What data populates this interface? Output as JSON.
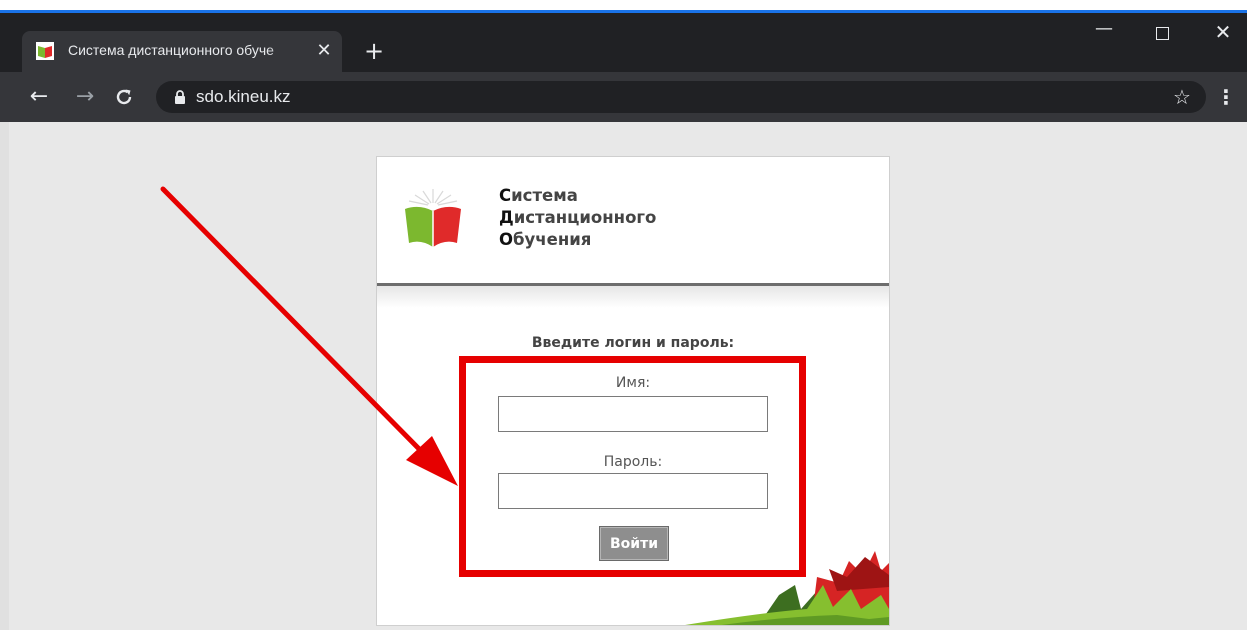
{
  "browser": {
    "tab_title": "Система дистанционного обуче",
    "tab_close_glyph": "✕",
    "new_tab_glyph": "+",
    "url": "sdo.kineu.kz",
    "window_controls": {
      "minimize": "—",
      "close": "✕"
    },
    "nav": {
      "back": "←",
      "forward": "→",
      "reload": "C"
    },
    "star_glyph": "☆",
    "menu_glyph": "⋮",
    "icons": [
      "book-favicon-icon",
      "close-icon",
      "plus-icon",
      "back-arrow-icon",
      "forward-arrow-icon",
      "reload-icon",
      "lock-icon",
      "star-icon",
      "kebab-menu-icon"
    ]
  },
  "page": {
    "brand": {
      "line1_cap": "С",
      "line1_rest": "истема",
      "line2_cap": "Д",
      "line2_rest": "истанционного",
      "line3_cap": "О",
      "line3_rest": "бучения"
    },
    "form": {
      "prompt": "Введите логин и пароль:",
      "username_label": "Имя:",
      "username_value": "",
      "password_label": "Пароль:",
      "password_value": "",
      "submit_label": "Войти"
    }
  },
  "colors": {
    "highlight": "#e60000",
    "logo_green": "#7cb82f",
    "logo_red": "#e02a2a",
    "button_gray": "#8e8e8e"
  }
}
